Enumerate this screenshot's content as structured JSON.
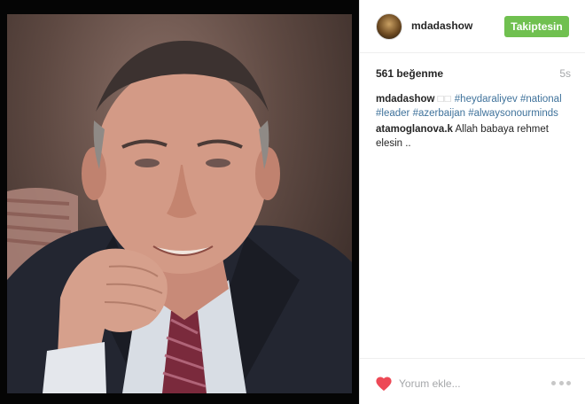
{
  "post": {
    "username": "mdadashow",
    "follow_label": "Takiptesin",
    "likes": "561 beğenme",
    "time": "5s",
    "caption": {
      "user": "mdadashow",
      "glyphs": "□□",
      "tags": [
        "#heydaraliyev",
        "#national",
        "#leader",
        "#azerbaijan",
        "#alwaysonourminds"
      ]
    },
    "comments": [
      {
        "user": "atamoglanova.k",
        "text": "Allah babaya rehmet elesin .."
      }
    ],
    "comment_placeholder": "Yorum ekle...",
    "icons": {
      "like": "heart-icon",
      "more": "more-options-icon"
    },
    "colors": {
      "follow": "#70c050",
      "hashtag": "#3f729b",
      "heart": "#ed4956"
    }
  }
}
